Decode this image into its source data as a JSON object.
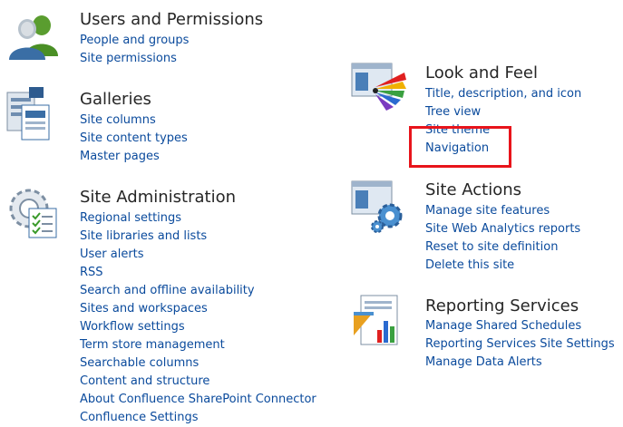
{
  "sections": {
    "users": {
      "title": "Users and Permissions",
      "icon": "users-icon",
      "links": [
        "People and groups",
        "Site permissions"
      ]
    },
    "galleries": {
      "title": "Galleries",
      "icon": "galleries-icon",
      "links": [
        "Site columns",
        "Site content types",
        "Master pages"
      ]
    },
    "admin": {
      "title": "Site Administration",
      "icon": "site-admin-gear-icon",
      "links": [
        "Regional settings",
        "Site libraries and lists",
        "User alerts",
        "RSS",
        "Search and offline availability",
        "Sites and workspaces",
        "Workflow settings",
        "Term store management",
        "Searchable columns",
        "Content and structure",
        "About Confluence SharePoint Connector",
        "Confluence Settings"
      ]
    },
    "look": {
      "title": "Look and Feel",
      "icon": "look-and-feel-palette-icon",
      "links": [
        "Title, description, and icon",
        "Tree view",
        "Site theme",
        "Navigation"
      ]
    },
    "actions": {
      "title": "Site Actions",
      "icon": "site-actions-gear-icon",
      "links": [
        "Manage site features",
        "Site Web Analytics reports",
        "Reset to site definition",
        "Delete this site"
      ]
    },
    "reporting": {
      "title": "Reporting Services",
      "icon": "reporting-services-icon",
      "links": [
        "Manage Shared Schedules",
        "Reporting Services Site Settings",
        "Manage Data Alerts"
      ]
    }
  },
  "colors": {
    "link": "#0a4a9c",
    "title": "#262626",
    "highlight": "#e8141b"
  },
  "highlighted_link": "Navigation"
}
